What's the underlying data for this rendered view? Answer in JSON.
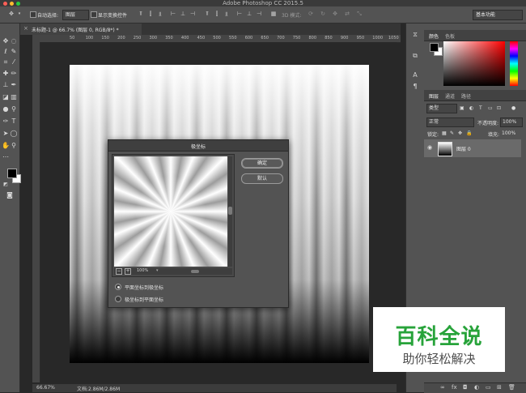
{
  "app": {
    "title": "Adobe Photoshop CC 2015.5"
  },
  "options_bar": {
    "auto_select_label": "自动选择:",
    "auto_select_value": "图层",
    "show_transform_label": "显示变换控件",
    "mode_3d_label": "3D 模式:",
    "workspace": "基本功能"
  },
  "document": {
    "tab_label": "未标题-1 @ 66.7% (图层 0, RGB/8*) *",
    "ruler_marks": [
      "50",
      "100",
      "150",
      "200",
      "250",
      "300",
      "350",
      "400",
      "450",
      "500",
      "550",
      "600",
      "650",
      "700",
      "750",
      "800",
      "850",
      "900",
      "950",
      "1000",
      "1050"
    ]
  },
  "status_bar": {
    "zoom": "66.67%",
    "doc_size": "文档:2.86M/2.86M"
  },
  "dialog": {
    "title": "极坐标",
    "ok_label": "确定",
    "default_label": "默认",
    "preview_zoom": "100%",
    "options": [
      {
        "label": "平面坐标到极坐标",
        "selected": true
      },
      {
        "label": "极坐标到平面坐标",
        "selected": false
      }
    ]
  },
  "color_panel": {
    "tabs": [
      "颜色",
      "色板"
    ],
    "foreground": "#000000",
    "background": "#ffffff"
  },
  "layers_panel": {
    "tabs": [
      "图层",
      "通道",
      "路径"
    ],
    "filter_label": "类型",
    "blend_mode": "正常",
    "opacity_label": "不透明度:",
    "opacity_value": "100%",
    "lock_label": "锁定:",
    "fill_label": "填充:",
    "fill_value": "100%",
    "layer_name": "图层 0"
  },
  "watermark": {
    "main": "百科全说",
    "sub": "助你轻松解决"
  }
}
